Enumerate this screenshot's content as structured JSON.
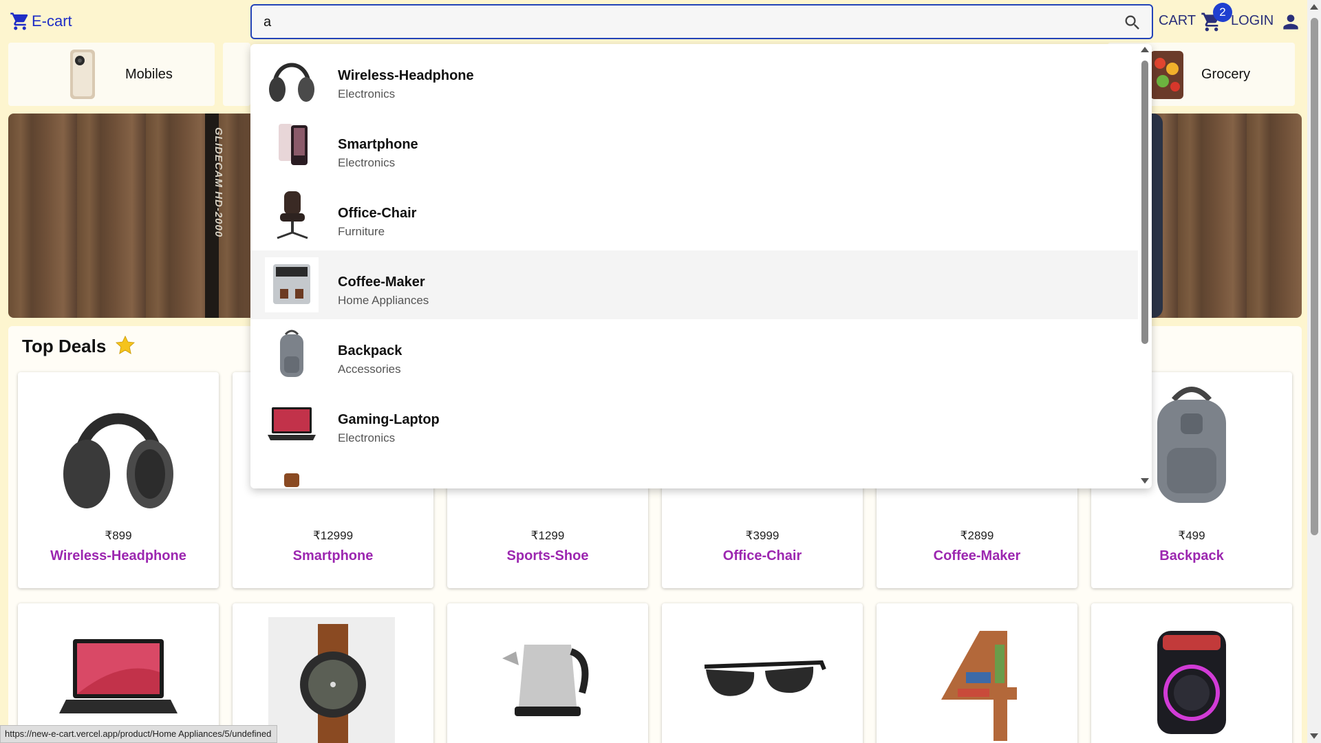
{
  "header": {
    "logo_text": "E-cart",
    "search_value": "a",
    "cart_label": "CART",
    "cart_count": "2",
    "login_label": "LOGIN"
  },
  "categories": [
    {
      "label": "Mobiles"
    },
    {
      "label": "Grocery"
    }
  ],
  "banner": {
    "text": "GLIDECAM HD-2000"
  },
  "deals": {
    "title": "Top Deals",
    "products_row1": [
      {
        "price": "₹899",
        "name": "Wireless-Headphone"
      },
      {
        "price": "₹12999",
        "name": "Smartphone"
      },
      {
        "price": "₹1299",
        "name": "Sports-Shoe"
      },
      {
        "price": "₹3999",
        "name": "Office-Chair"
      },
      {
        "price": "₹2899",
        "name": "Coffee-Maker"
      },
      {
        "price": "₹499",
        "name": "Backpack"
      }
    ],
    "products_row2": [
      "gaming-laptop",
      "wrist-watch",
      "electric-kettle",
      "sunglasses",
      "bookshelf",
      "party-speaker"
    ]
  },
  "search_dropdown": {
    "suggestions": [
      {
        "name": "Wireless-Headphone",
        "category": "Electronics"
      },
      {
        "name": "Smartphone",
        "category": "Electronics"
      },
      {
        "name": "Office-Chair",
        "category": "Furniture"
      },
      {
        "name": "Coffee-Maker",
        "category": "Home Appliances",
        "highlighted": true
      },
      {
        "name": "Backpack",
        "category": "Accessories"
      },
      {
        "name": "Gaming-Laptop",
        "category": "Electronics"
      }
    ]
  },
  "status_bar": {
    "url": "https://new-e-cart.vercel.app/product/Home Appliances/5/undefined"
  },
  "colors": {
    "accent": "#1f2ec6",
    "product_name": "#9c27b0",
    "background": "#fdf5cf"
  }
}
